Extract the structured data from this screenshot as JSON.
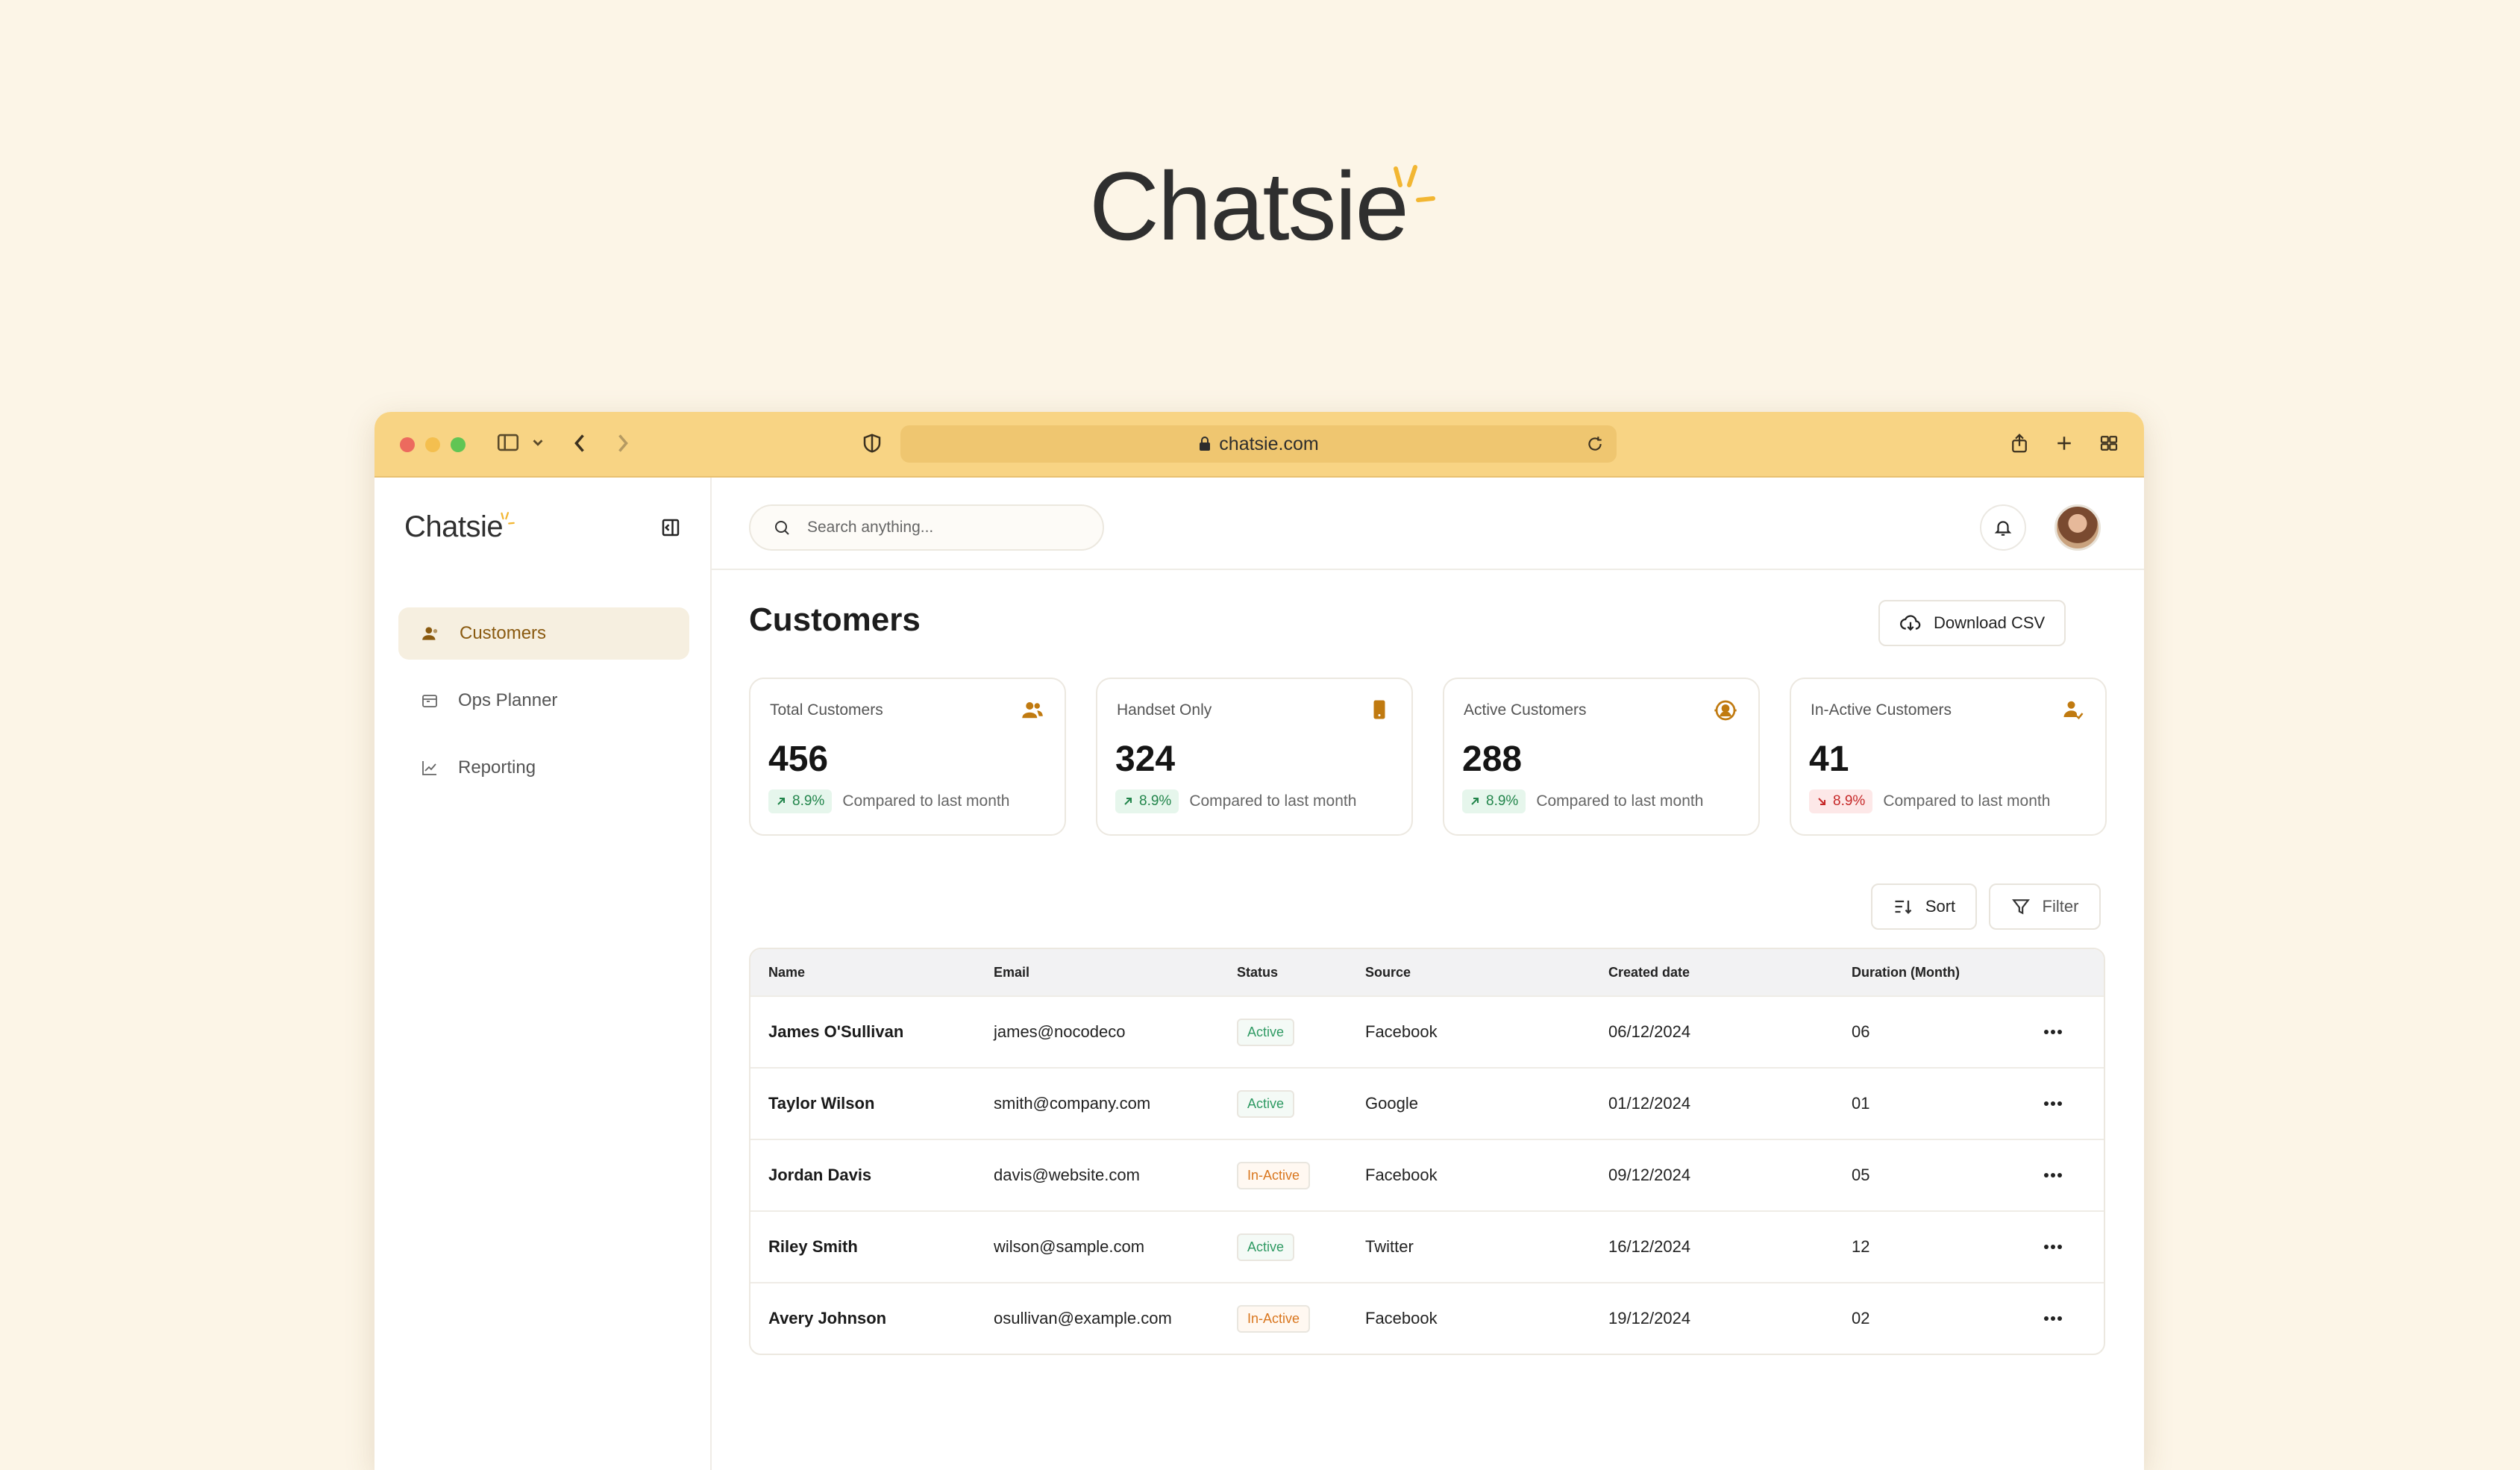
{
  "brand": {
    "name": "Chatsie",
    "accent": "#f2b632"
  },
  "browser": {
    "url": "chatsie.com",
    "titlebar_color": "#f8d484"
  },
  "sidebar": {
    "logo": "Chatsie",
    "items": [
      {
        "label": "Customers",
        "icon": "users-icon",
        "active": true
      },
      {
        "label": "Ops Planner",
        "icon": "calendar-icon",
        "active": false
      },
      {
        "label": "Reporting",
        "icon": "chart-line-icon",
        "active": false
      }
    ]
  },
  "topbar": {
    "search_placeholder": "Search anything...",
    "notifications_icon": "bell-icon"
  },
  "page": {
    "title": "Customers",
    "download_label": "Download CSV"
  },
  "stats": [
    {
      "label": "Total Customers",
      "value": "456",
      "change": "8.9%",
      "direction": "up",
      "compare": "Compared to last month",
      "icon": "users-icon"
    },
    {
      "label": "Handset Only",
      "value": "324",
      "change": "8.9%",
      "direction": "up",
      "compare": "Compared to last month",
      "icon": "phone-icon"
    },
    {
      "label": "Active Customers",
      "value": "288",
      "change": "8.9%",
      "direction": "up",
      "compare": "Compared to last month",
      "icon": "user-active-icon"
    },
    {
      "label": "In-Active Customers",
      "value": "41",
      "change": "8.9%",
      "direction": "down",
      "compare": "Compared to last month",
      "icon": "user-check-icon"
    }
  ],
  "toolbar": {
    "sort_label": "Sort",
    "filter_label": "Filter"
  },
  "table": {
    "columns": [
      "Name",
      "Email",
      "Status",
      "Source",
      "Created date",
      "Duration (Month)"
    ],
    "rows": [
      {
        "name": "James O'Sullivan",
        "email": "james@nocodeco",
        "status": "Active",
        "source": "Facebook",
        "created": "06/12/2024",
        "duration": "06"
      },
      {
        "name": "Taylor Wilson",
        "email": "smith@company.com",
        "status": "Active",
        "source": "Google",
        "created": "01/12/2024",
        "duration": "01"
      },
      {
        "name": "Jordan Davis",
        "email": "davis@website.com",
        "status": "In-Active",
        "source": "Facebook",
        "created": "09/12/2024",
        "duration": "05"
      },
      {
        "name": "Riley Smith",
        "email": "wilson@sample.com",
        "status": "Active",
        "source": "Twitter",
        "created": "16/12/2024",
        "duration": "12"
      },
      {
        "name": "Avery Johnson",
        "email": "osullivan@example.com",
        "status": "In-Active",
        "source": "Facebook",
        "created": "19/12/2024",
        "duration": "02"
      }
    ]
  }
}
